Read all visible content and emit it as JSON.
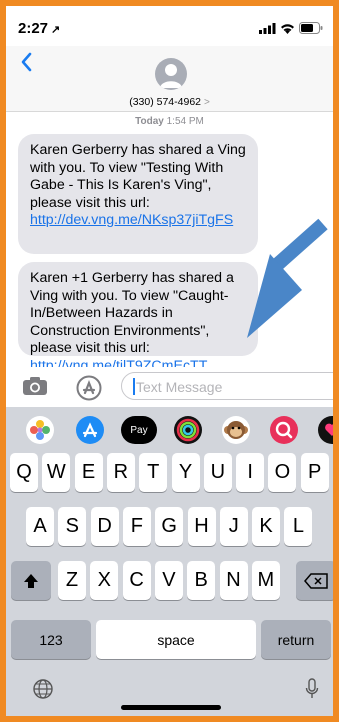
{
  "status_bar": {
    "time": "2:27",
    "location_glyph": "↗"
  },
  "header": {
    "contact": "(330) 574-4962",
    "chevron": ">"
  },
  "thread": {
    "timestamp_day": "Today",
    "timestamp_time": "1:54 PM",
    "messages": [
      {
        "text": "Karen Gerberry has shared a Ving with you.  To view \"Testing With Gabe - This Is Karen's Ving\", please visit this url: ",
        "link": "http://dev.vng.me/NKsp37jiTgFS"
      },
      {
        "text": "Karen +1 Gerberry has shared a Ving with you.  To view \"Caught-In/Between Hazards in Construction Environments\", please visit this url: ",
        "link": "http://vng.me/tilT9ZCmEcTT"
      }
    ]
  },
  "input": {
    "placeholder": "Text Message"
  },
  "app_drawer": [
    {
      "name": "photos-app-icon",
      "color": "#ffffff"
    },
    {
      "name": "app-store-icon",
      "color": "#1e8cf5"
    },
    {
      "name": "apple-pay-icon",
      "label": "Pay",
      "color": "#000000"
    },
    {
      "name": "activity-icon",
      "color": "#111111"
    },
    {
      "name": "monkey-animoji-icon",
      "color": "#ffffff"
    },
    {
      "name": "search-images-icon",
      "color": "#e8305a"
    },
    {
      "name": "digital-touch-icon",
      "color": "#111111"
    }
  ],
  "keyboard": {
    "row1": [
      "Q",
      "W",
      "E",
      "R",
      "T",
      "Y",
      "U",
      "I",
      "O",
      "P"
    ],
    "row2": [
      "A",
      "S",
      "D",
      "F",
      "G",
      "H",
      "J",
      "K",
      "L"
    ],
    "row3": [
      "Z",
      "X",
      "C",
      "V",
      "B",
      "N",
      "M"
    ],
    "numbers_label": "123",
    "space_label": "space",
    "return_label": "return"
  },
  "colors": {
    "frame": "#F08A22",
    "link": "#1a73e8",
    "annotation_arrow": "#4a86c8",
    "send": "#30c04a"
  }
}
